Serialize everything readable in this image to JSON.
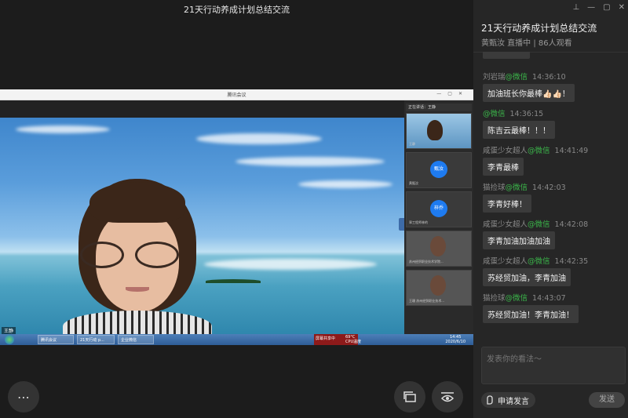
{
  "live": {
    "title": "21天行动养成计划总结交流",
    "shared_window_title": "腾讯会议",
    "speaking_label": "正在讲话：王静",
    "speaker_name": "王静",
    "participants": [
      {
        "name": "王静",
        "avatar_text": ""
      },
      {
        "name": "黄甄汝",
        "avatar_text": "甄汝"
      },
      {
        "name": "翠工程师林的",
        "avatar_text": "梓乔"
      },
      {
        "name": "苏州经贸职业技术学院...",
        "avatar_text": ""
      },
      {
        "name": "王珊 苏州经贸职业技术...",
        "avatar_text": ""
      }
    ],
    "taskbar": {
      "items": [
        "腾讯会议",
        "21天行动 p...",
        "企业微信"
      ],
      "popup": "屏幕共享中",
      "temp": "69°C",
      "temp_label": "CPU温度",
      "time": "14:45",
      "date": "2020/6/10"
    }
  },
  "chat": {
    "title": "21天行动养成计划总结交流",
    "subtitle": "黄甄汝 直播中 | 86人观看",
    "messages": [
      {
        "user": "刘岩瑞",
        "source": "@微信",
        "time": "14:36:10",
        "text": "加油班长你最棒👍🏻👍🏻！"
      },
      {
        "user": "",
        "source": "@微信",
        "time": "14:36:15",
        "text": "陈吉云最棒！！！"
      },
      {
        "user": "咸蛋少女超人",
        "source": "@微信",
        "time": "14:41:49",
        "text": "李青最棒"
      },
      {
        "user": "猫捡球",
        "source": "@微信",
        "time": "14:42:03",
        "text": "李青好棒！"
      },
      {
        "user": "咸蛋少女超人",
        "source": "@微信",
        "time": "14:42:08",
        "text": "李青加油加油加油"
      },
      {
        "user": "咸蛋少女超人",
        "source": "@微信",
        "time": "14:42:35",
        "text": "苏经贸加油，李青加油"
      },
      {
        "user": "猫捡球",
        "source": "@微信",
        "time": "14:43:07",
        "text": "苏经贸加油！李青加油！"
      }
    ],
    "input_placeholder": "发表你的看法～",
    "speak_button": "申请发言",
    "send_button": "发送"
  },
  "colors": {
    "accent_green": "#3bb54a",
    "avatar_blue": "#1e7bf0",
    "panel_bg": "#262626"
  },
  "icons": [
    "pin-icon",
    "minimize-icon",
    "maximize-icon",
    "close-icon",
    "more-icon",
    "screen-switch-icon",
    "eye-view-icon",
    "raise-hand-icon"
  ]
}
